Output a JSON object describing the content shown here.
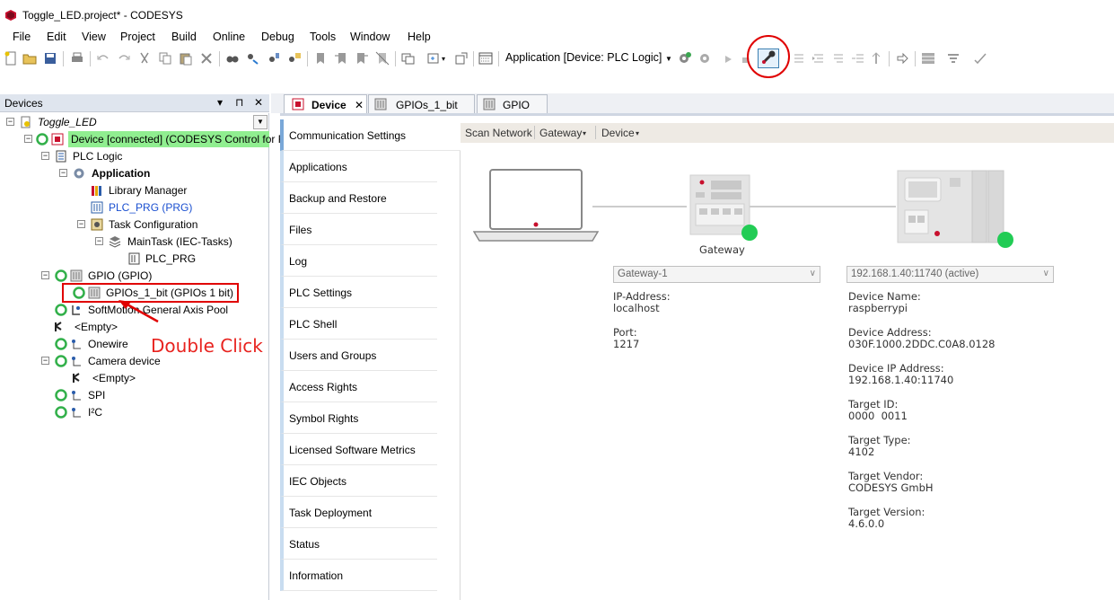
{
  "window": {
    "title": "Toggle_LED.project* - CODESYS"
  },
  "menu": [
    "File",
    "Edit",
    "View",
    "Project",
    "Build",
    "Online",
    "Debug",
    "Tools",
    "Window",
    "Help"
  ],
  "toolbar": {
    "application_combo": "Application [Device: PLC Logic]"
  },
  "devices_panel": {
    "title": "Devices",
    "controls": [
      "▾",
      "⊓",
      "✕"
    ],
    "tree": [
      {
        "label": "Toggle_LED"
      },
      {
        "label": "Device [connected] (CODESYS Control for Ras"
      },
      {
        "label": "PLC Logic"
      },
      {
        "label": "Application"
      },
      {
        "label": "Library Manager"
      },
      {
        "label": "PLC_PRG (PRG)"
      },
      {
        "label": "Task Configuration"
      },
      {
        "label": "MainTask (IEC-Tasks)"
      },
      {
        "label": "PLC_PRG"
      },
      {
        "label": "GPIO (GPIO)"
      },
      {
        "label": "GPIOs_1_bit (GPIOs 1 bit)"
      },
      {
        "label": "SoftMotion General Axis Pool"
      },
      {
        "label": "<Empty>"
      },
      {
        "label": "Onewire"
      },
      {
        "label": "Camera device"
      },
      {
        "label": "<Empty>"
      },
      {
        "label": "SPI"
      },
      {
        "label": "I²C"
      }
    ]
  },
  "annotation": {
    "text": "Double Click"
  },
  "editor": {
    "tabs": [
      "Device",
      "GPIOs_1_bit",
      "GPIO"
    ],
    "side_menu": [
      "Communication Settings",
      "Applications",
      "Backup and Restore",
      "Files",
      "Log",
      "PLC Settings",
      "PLC Shell",
      "Users and Groups",
      "Access Rights",
      "Symbol Rights",
      "Licensed Software Metrics",
      "IEC Objects",
      "Task Deployment",
      "Status",
      "Information"
    ],
    "toolbar": [
      "Scan Network",
      "Gateway",
      "Device"
    ],
    "gateway_label": "Gateway",
    "gateway_combo": "Gateway-1",
    "device_combo": "192.168.1.40:11740 (active)",
    "gateway_info": [
      {
        "label": "IP-Address:",
        "value": "localhost"
      },
      {
        "label": "Port:",
        "value": "1217"
      }
    ],
    "device_info": [
      {
        "label": "Device Name:",
        "value": "raspberrypi"
      },
      {
        "label": "Device Address:",
        "value": "030F.1000.2DDC.C0A8.0128"
      },
      {
        "label": "Device IP Address:",
        "value": "192.168.1.40:11740"
      },
      {
        "label": "Target ID:",
        "value": "0000  0011"
      },
      {
        "label": "Target Type:",
        "value": "4102"
      },
      {
        "label": "Target Vendor:",
        "value": "CODESYS GmbH"
      },
      {
        "label": "Target Version:",
        "value": "4.6.0.0"
      }
    ]
  },
  "colors": {
    "connected": "#90ee90",
    "annotation": "#e00000",
    "status_ok": "#22cc55"
  }
}
